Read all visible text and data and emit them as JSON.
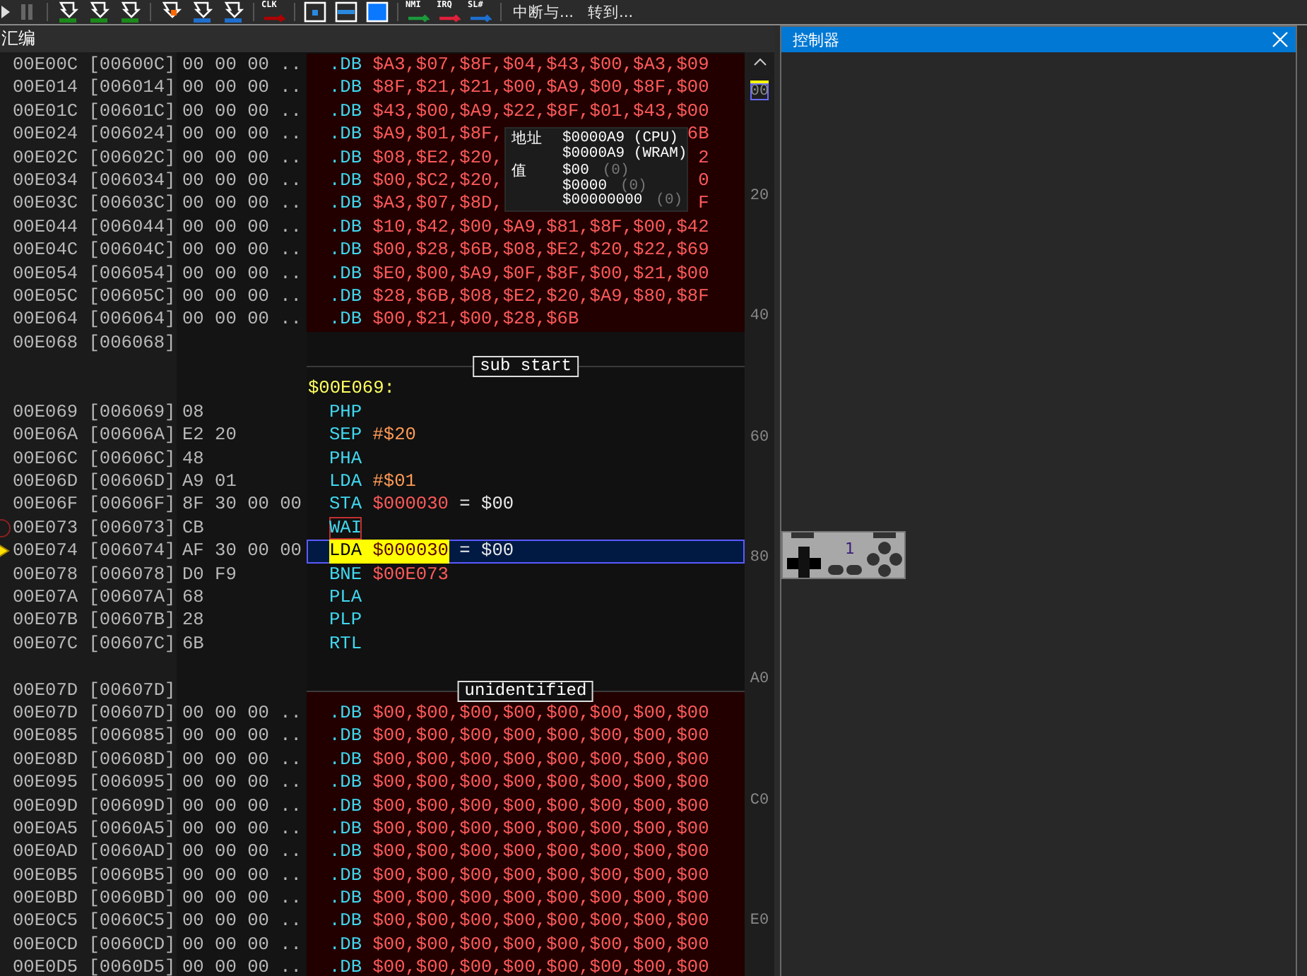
{
  "toolbar": {
    "tagged_buttons": [
      {
        "tag": "CLK"
      },
      {
        "tag": "NMI"
      },
      {
        "tag": "IRQ"
      },
      {
        "tag": "SL#"
      }
    ],
    "text_buttons": [
      "中断与...",
      "转到..."
    ]
  },
  "disassembly": {
    "title": "汇编",
    "rows": [
      {
        "kind": "data",
        "address": "00E00C [00600C]",
        "bytes": "00 00 00 ..",
        "directive": ".DB",
        "operand": "$A3,$07,$8F,$04,$43,$00,$A3,$09"
      },
      {
        "kind": "data",
        "address": "00E014 [006014]",
        "bytes": "00 00 00 ..",
        "directive": ".DB",
        "operand": "$8F,$21,$21,$00,$A9,$00,$8F,$00"
      },
      {
        "kind": "data",
        "address": "00E01C [00601C]",
        "bytes": "00 00 00 ..",
        "directive": ".DB",
        "operand": "$43,$00,$A9,$22,$8F,$01,$43,$00"
      },
      {
        "kind": "data",
        "address": "00E024 [006024]",
        "bytes": "00 00 00 ..",
        "directive": ".DB",
        "operand": "$A9,$01,$8F,",
        "operand_tail": "6B"
      },
      {
        "kind": "data",
        "address": "00E02C [00602C]",
        "bytes": "00 00 00 ..",
        "directive": ".DB",
        "operand": "$08,$E2,$20,",
        "operand_tail": "2"
      },
      {
        "kind": "data",
        "address": "00E034 [006034]",
        "bytes": "00 00 00 ..",
        "directive": ".DB",
        "operand": "$00,$C2,$20,",
        "operand_tail": "0"
      },
      {
        "kind": "data",
        "address": "00E03C [00603C]",
        "bytes": "00 00 00 ..",
        "directive": ".DB",
        "operand": "$A3,$07,$8D,",
        "operand_tail": "F"
      },
      {
        "kind": "data",
        "address": "00E044 [006044]",
        "bytes": "00 00 00 ..",
        "directive": ".DB",
        "operand": "$10,$42,$00,$A9,$81,$8F,$00,$42"
      },
      {
        "kind": "data",
        "address": "00E04C [00604C]",
        "bytes": "00 00 00 ..",
        "directive": ".DB",
        "operand": "$00,$28,$6B,$08,$E2,$20,$22,$69"
      },
      {
        "kind": "data",
        "address": "00E054 [006054]",
        "bytes": "00 00 00 ..",
        "directive": ".DB",
        "operand": "$E0,$00,$A9,$0F,$8F,$00,$21,$00"
      },
      {
        "kind": "data",
        "address": "00E05C [00605C]",
        "bytes": "00 00 00 ..",
        "directive": ".DB",
        "operand": "$28,$6B,$08,$E2,$20,$A9,$80,$8F"
      },
      {
        "kind": "data",
        "address": "00E064 [006064]",
        "bytes": "00 00 00 ..",
        "directive": ".DB",
        "operand": "$00,$21,$00,$28,$6B"
      },
      {
        "kind": "end",
        "address": "00E068 [006068]"
      },
      {
        "kind": "banner",
        "title": "sub start"
      },
      {
        "kind": "label",
        "text": "$00E069:"
      },
      {
        "kind": "code",
        "address": "00E069 [006069]",
        "bytes": "08",
        "mnemonic": "PHP",
        "breakpoint": false,
        "marked": false,
        "current": false,
        "selected": false
      },
      {
        "kind": "code",
        "address": "00E06A [00606A]",
        "bytes": "E2 20",
        "mnemonic": "SEP",
        "operand": {
          "text": "#$20",
          "kind": "immediate"
        },
        "breakpoint": false,
        "marked": false,
        "current": false,
        "selected": false
      },
      {
        "kind": "code",
        "address": "00E06C [00606C]",
        "bytes": "48",
        "mnemonic": "PHA",
        "breakpoint": false,
        "marked": false,
        "current": false,
        "selected": false
      },
      {
        "kind": "code",
        "address": "00E06D [00606D]",
        "bytes": "A9 01",
        "mnemonic": "LDA",
        "operand": {
          "text": "#$01",
          "kind": "immediate"
        },
        "breakpoint": false,
        "marked": false,
        "current": false,
        "selected": false
      },
      {
        "kind": "code",
        "address": "00E06F [00606F]",
        "bytes": "8F 30 00 00",
        "mnemonic": "STA",
        "operand": {
          "text": "$000030",
          "kind": "address"
        },
        "value": "= $00",
        "breakpoint": false,
        "marked": false,
        "current": false,
        "selected": false
      },
      {
        "kind": "code",
        "address": "00E073 [006073]",
        "bytes": "CB",
        "mnemonic": "WAI",
        "breakpoint": true,
        "marked": true,
        "current": false,
        "selected": false
      },
      {
        "kind": "code",
        "address": "00E074 [006074]",
        "bytes": "AF 30 00 00",
        "mnemonic": "LDA",
        "operand": {
          "text": "$000030",
          "kind": "address"
        },
        "value": "= $00",
        "breakpoint": false,
        "marked": false,
        "current": true,
        "selected": true
      },
      {
        "kind": "code",
        "address": "00E078 [006078]",
        "bytes": "D0 F9",
        "mnemonic": "BNE",
        "operand": {
          "text": "$00E073",
          "kind": "address"
        },
        "breakpoint": false,
        "marked": false,
        "current": false,
        "selected": false
      },
      {
        "kind": "code",
        "address": "00E07A [00607A]",
        "bytes": "68",
        "mnemonic": "PLA",
        "breakpoint": false,
        "marked": false,
        "current": false,
        "selected": false
      },
      {
        "kind": "code",
        "address": "00E07B [00607B]",
        "bytes": "28",
        "mnemonic": "PLP",
        "breakpoint": false,
        "marked": false,
        "current": false,
        "selected": false
      },
      {
        "kind": "code",
        "address": "00E07C [00607C]",
        "bytes": "6B",
        "mnemonic": "RTL",
        "breakpoint": false,
        "marked": false,
        "current": false,
        "selected": false
      },
      {
        "kind": "spacer"
      },
      {
        "kind": "banner",
        "title": "unidentified",
        "address": "00E07D [00607D]"
      },
      {
        "kind": "data",
        "address": "00E07D [00607D]",
        "bytes": "00 00 00 ..",
        "directive": ".DB",
        "operand": "$00,$00,$00,$00,$00,$00,$00,$00"
      },
      {
        "kind": "data",
        "address": "00E085 [006085]",
        "bytes": "00 00 00 ..",
        "directive": ".DB",
        "operand": "$00,$00,$00,$00,$00,$00,$00,$00"
      },
      {
        "kind": "data",
        "address": "00E08D [00608D]",
        "bytes": "00 00 00 ..",
        "directive": ".DB",
        "operand": "$00,$00,$00,$00,$00,$00,$00,$00"
      },
      {
        "kind": "data",
        "address": "00E095 [006095]",
        "bytes": "00 00 00 ..",
        "directive": ".DB",
        "operand": "$00,$00,$00,$00,$00,$00,$00,$00"
      },
      {
        "kind": "data",
        "address": "00E09D [00609D]",
        "bytes": "00 00 00 ..",
        "directive": ".DB",
        "operand": "$00,$00,$00,$00,$00,$00,$00,$00"
      },
      {
        "kind": "data",
        "address": "00E0A5 [0060A5]",
        "bytes": "00 00 00 ..",
        "directive": ".DB",
        "operand": "$00,$00,$00,$00,$00,$00,$00,$00"
      },
      {
        "kind": "data",
        "address": "00E0AD [0060AD]",
        "bytes": "00 00 00 ..",
        "directive": ".DB",
        "operand": "$00,$00,$00,$00,$00,$00,$00,$00"
      },
      {
        "kind": "data",
        "address": "00E0B5 [0060B5]",
        "bytes": "00 00 00 ..",
        "directive": ".DB",
        "operand": "$00,$00,$00,$00,$00,$00,$00,$00"
      },
      {
        "kind": "data",
        "address": "00E0BD [0060BD]",
        "bytes": "00 00 00 ..",
        "directive": ".DB",
        "operand": "$00,$00,$00,$00,$00,$00,$00,$00"
      },
      {
        "kind": "data",
        "address": "00E0C5 [0060C5]",
        "bytes": "00 00 00 ..",
        "directive": ".DB",
        "operand": "$00,$00,$00,$00,$00,$00,$00,$00"
      },
      {
        "kind": "data",
        "address": "00E0CD [0060CD]",
        "bytes": "00 00 00 ..",
        "directive": ".DB",
        "operand": "$00,$00,$00,$00,$00,$00,$00,$00"
      },
      {
        "kind": "data",
        "address": "00E0D5 [0060D5]",
        "bytes": "00 00 00 ..",
        "directive": ".DB",
        "operand": "$00,$00,$00,$00,$00,$00,$00,$00"
      }
    ],
    "tooltip": {
      "rows": [
        {
          "label": "地址",
          "values": [
            {
              "text": "$0000A9 (CPU)"
            },
            {
              "text": "$0000A9 (WRAM)"
            }
          ]
        },
        {
          "label": "值",
          "values": [
            {
              "text": "$00",
              "note": "(0)"
            },
            {
              "text": "$0000",
              "note": "(0)"
            },
            {
              "text": "$00000000",
              "note": "(0)"
            }
          ]
        }
      ]
    },
    "ruler": [
      {
        "text": "00",
        "selected": true
      },
      {
        "text": "20",
        "selected": false
      },
      {
        "text": "40",
        "selected": false
      },
      {
        "text": "60",
        "selected": false
      },
      {
        "text": "80",
        "selected": false
      },
      {
        "text": "A0",
        "selected": false
      },
      {
        "text": "C0",
        "selected": false
      },
      {
        "text": "E0",
        "selected": false
      }
    ]
  },
  "controller_panel": {
    "title": "控制器",
    "controllers": [
      {
        "port": "1"
      }
    ]
  }
}
